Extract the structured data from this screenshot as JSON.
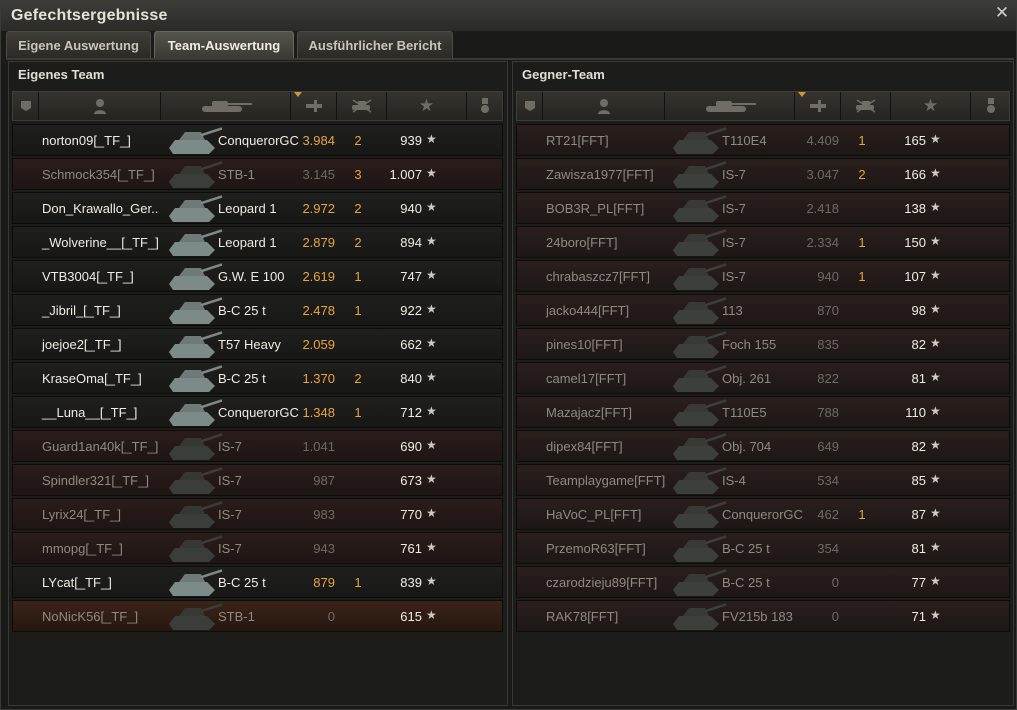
{
  "window": {
    "title": "Gefechtsergebnisse",
    "close_icon": "close-icon"
  },
  "tabs": [
    {
      "label": "Eigene Auswertung",
      "active": false
    },
    {
      "label": "Team-Auswertung",
      "active": true
    },
    {
      "label": "Ausführlicher Bericht",
      "active": false
    }
  ],
  "header_icons": [
    "squad-icon",
    "player-icon",
    "tank-icon",
    "damage-icon",
    "kills-icon",
    "xp-star-icon",
    "medal-icon"
  ],
  "own_team": {
    "title": "Eigenes Team",
    "players": [
      {
        "name": "norton09[_TF_]",
        "tank": "ConquerorGC",
        "damage": "3.984",
        "kills": "2",
        "xp": "939",
        "alive": true
      },
      {
        "name": "Schmock354[_TF_]",
        "tank": "STB-1",
        "damage": "3.145",
        "kills": "3",
        "xp": "1.007",
        "alive": false
      },
      {
        "name": "Don_Krawallo_Ger..",
        "tank": "Leopard 1",
        "damage": "2.972",
        "kills": "2",
        "xp": "940",
        "alive": true
      },
      {
        "name": "_Wolverine__[_TF_]",
        "tank": "Leopard 1",
        "damage": "2.879",
        "kills": "2",
        "xp": "894",
        "alive": true
      },
      {
        "name": "VTB3004[_TF_]",
        "tank": "G.W. E 100",
        "damage": "2.619",
        "kills": "1",
        "xp": "747",
        "alive": true
      },
      {
        "name": "_Jibril_[_TF_]",
        "tank": "B-C 25 t",
        "damage": "2.478",
        "kills": "1",
        "xp": "922",
        "alive": true
      },
      {
        "name": "joejoe2[_TF_]",
        "tank": "T57 Heavy",
        "damage": "2.059",
        "kills": "",
        "xp": "662",
        "alive": true
      },
      {
        "name": "KraseOma[_TF_]",
        "tank": "B-C 25 t",
        "damage": "1.370",
        "kills": "2",
        "xp": "840",
        "alive": true
      },
      {
        "name": "__Luna__[_TF_]",
        "tank": "ConquerorGC",
        "damage": "1.348",
        "kills": "1",
        "xp": "712",
        "alive": true
      },
      {
        "name": "Guard1an40k[_TF_]",
        "tank": "IS-7",
        "damage": "1.041",
        "kills": "",
        "xp": "690",
        "alive": false
      },
      {
        "name": "Spindler321[_TF_]",
        "tank": "IS-7",
        "damage": "987",
        "kills": "",
        "xp": "673",
        "alive": false
      },
      {
        "name": "Lyrix24[_TF_]",
        "tank": "IS-7",
        "damage": "983",
        "kills": "",
        "xp": "770",
        "alive": false
      },
      {
        "name": "mmopg[_TF_]",
        "tank": "IS-7",
        "damage": "943",
        "kills": "",
        "xp": "761",
        "alive": false
      },
      {
        "name": "LYcat[_TF_]",
        "tank": "B-C 25 t",
        "damage": "879",
        "kills": "1",
        "xp": "839",
        "alive": true
      },
      {
        "name": "NoNicK56[_TF_]",
        "tank": "STB-1",
        "damage": "0",
        "kills": "",
        "xp": "615",
        "alive": false,
        "self": true
      }
    ]
  },
  "enemy_team": {
    "title": "Gegner-Team",
    "players": [
      {
        "name": "RT21[FFT]",
        "tank": "T110E4",
        "damage": "4.409",
        "kills": "1",
        "xp": "165"
      },
      {
        "name": "Zawisza1977[FFT]",
        "tank": "IS-7",
        "damage": "3.047",
        "kills": "2",
        "xp": "166"
      },
      {
        "name": "BOB3R_PL[FFT]",
        "tank": "IS-7",
        "damage": "2.418",
        "kills": "",
        "xp": "138"
      },
      {
        "name": "24boro[FFT]",
        "tank": "IS-7",
        "damage": "2.334",
        "kills": "1",
        "xp": "150"
      },
      {
        "name": "chrabaszcz7[FFT]",
        "tank": "IS-7",
        "damage": "940",
        "kills": "1",
        "xp": "107"
      },
      {
        "name": "jacko444[FFT]",
        "tank": "113",
        "damage": "870",
        "kills": "",
        "xp": "98"
      },
      {
        "name": "pines10[FFT]",
        "tank": "Foch 155",
        "damage": "835",
        "kills": "",
        "xp": "82"
      },
      {
        "name": "camel17[FFT]",
        "tank": "Obj. 261",
        "damage": "822",
        "kills": "",
        "xp": "81"
      },
      {
        "name": "Mazajacz[FFT]",
        "tank": "T110E5",
        "damage": "788",
        "kills": "",
        "xp": "110"
      },
      {
        "name": "dipex84[FFT]",
        "tank": "Obj. 704",
        "damage": "649",
        "kills": "",
        "xp": "82"
      },
      {
        "name": "Teamplaygame[FFT]",
        "tank": "IS-4",
        "damage": "534",
        "kills": "",
        "xp": "85"
      },
      {
        "name": "HaVoC_PL[FFT]",
        "tank": "ConquerorGC",
        "damage": "462",
        "kills": "1",
        "xp": "87"
      },
      {
        "name": "PrzemoR63[FFT]",
        "tank": "B-C 25 t",
        "damage": "354",
        "kills": "",
        "xp": "81"
      },
      {
        "name": "czarodzieju89[FFT]",
        "tank": "B-C 25 t",
        "damage": "0",
        "kills": "",
        "xp": "77"
      },
      {
        "name": "RAK78[FFT]",
        "tank": "FV215b 183",
        "damage": "0",
        "kills": "",
        "xp": "71"
      }
    ]
  },
  "colors": {
    "accent": "#e8a445",
    "text": "#f0ece2",
    "dim": "#8f8a80"
  }
}
